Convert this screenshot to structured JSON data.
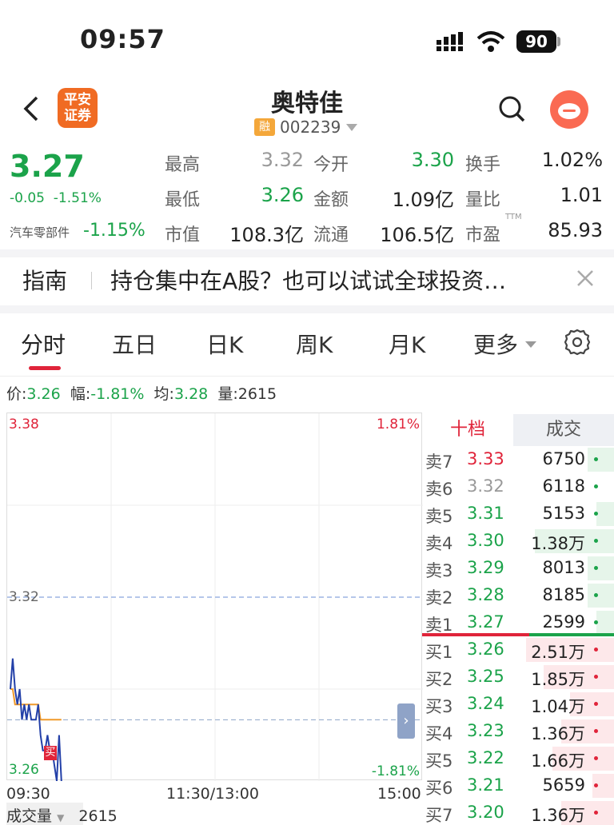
{
  "status_bar": {
    "time": "09:57",
    "battery": "90"
  },
  "header": {
    "title": "奥特佳",
    "rong_badge": "融",
    "code": "002239",
    "broker_logo": "平安\n证券"
  },
  "quote": {
    "price": "3.27",
    "change": "-0.05  -1.51%",
    "industry": "汽车零部件",
    "industry_change": "-1.15%",
    "grid": [
      {
        "label": "最高",
        "value": "3.32",
        "label2": "今开",
        "value2": "3.30",
        "label3": "换手",
        "value3": "1.02%"
      },
      {
        "label": "最低",
        "value": "3.26",
        "label2": "金额",
        "value2": "1.09亿",
        "label3": "量比",
        "value3": "1.01"
      },
      {
        "label": "市值",
        "value": "108.3亿",
        "label2": "流通",
        "value2": "106.5亿",
        "label3": "市盈",
        "value3": "85.93",
        "ttm": "TTM"
      }
    ]
  },
  "guide": {
    "label": "指南",
    "text": "持仓集中在A股？也可以试试全球投资…"
  },
  "tabs": [
    "分时",
    "五日",
    "日K",
    "周K",
    "月K",
    "更多"
  ],
  "info": {
    "price_label": "价:",
    "price": "3.26",
    "amp_label": "幅:",
    "amp": "-1.81%",
    "avg_label": "均:",
    "avg": "3.28",
    "vol_label": "量:",
    "vol": "2615"
  },
  "chart_data": {
    "type": "line",
    "y_top": "3.38",
    "y_mid": "3.32",
    "y_bottom": "3.26",
    "pct_top": "1.81%",
    "pct_bottom": "-1.81%",
    "x_labels": [
      "09:30",
      "11:30/13:00",
      "15:00"
    ],
    "ylim": [
      3.26,
      3.38
    ],
    "reference_price": 3.32,
    "marker_label": "买",
    "series": [
      {
        "values": [
          3.29,
          3.3,
          3.29,
          3.285,
          3.29,
          3.28,
          3.285,
          3.28,
          3.285,
          3.28,
          3.28,
          3.28,
          3.285,
          3.275,
          3.27,
          3.27,
          3.275,
          3.27,
          3.27,
          3.265,
          3.26,
          3.275,
          3.26
        ]
      },
      {
        "values": [
          3.29,
          3.29,
          3.285,
          3.285,
          3.285,
          3.285,
          3.285,
          3.285,
          3.285,
          3.285,
          3.285,
          3.285,
          3.285,
          3.28,
          3.28,
          3.28,
          3.28,
          3.28,
          3.28,
          3.28,
          3.28,
          3.28,
          3.28
        ]
      }
    ]
  },
  "order_book": {
    "tab_left": "十档",
    "tab_right": "成交",
    "asks": [
      {
        "label": "卖7",
        "price": "3.33",
        "vol": "6750",
        "color": "red",
        "bar": 0.3
      },
      {
        "label": "卖6",
        "price": "3.32",
        "vol": "6118",
        "color": "gray",
        "bar": 0.0
      },
      {
        "label": "卖5",
        "price": "3.31",
        "vol": "5153",
        "color": "green",
        "bar": 0.2
      },
      {
        "label": "卖4",
        "price": "3.30",
        "vol": "1.38万",
        "color": "green",
        "bar": 0.9
      },
      {
        "label": "卖3",
        "price": "3.29",
        "vol": "8013",
        "color": "green",
        "bar": 0.3
      },
      {
        "label": "卖2",
        "price": "3.28",
        "vol": "8185",
        "color": "green",
        "bar": 0.3
      },
      {
        "label": "卖1",
        "price": "3.27",
        "vol": "2599",
        "color": "green",
        "bar": 0.2
      }
    ],
    "bids": [
      {
        "label": "买1",
        "price": "3.26",
        "vol": "2.51万",
        "color": "green",
        "bar": 1.0
      },
      {
        "label": "买2",
        "price": "3.25",
        "vol": "1.85万",
        "color": "green",
        "bar": 0.8
      },
      {
        "label": "买3",
        "price": "3.24",
        "vol": "1.04万",
        "color": "green",
        "bar": 0.5
      },
      {
        "label": "买4",
        "price": "3.23",
        "vol": "1.36万",
        "color": "green",
        "bar": 0.6
      },
      {
        "label": "买5",
        "price": "3.22",
        "vol": "1.66万",
        "color": "green",
        "bar": 0.7
      },
      {
        "label": "买6",
        "price": "3.21",
        "vol": "5659",
        "color": "green",
        "bar": 0.25
      },
      {
        "label": "买7",
        "price": "3.20",
        "vol": "1.36万",
        "color": "green",
        "bar": 0.6
      }
    ]
  },
  "volume": {
    "label": "成交量",
    "value": "2615"
  },
  "colors": {
    "up": "#e0243a",
    "down": "#1ba34a",
    "flat": "#999999",
    "ask_bg": "#e6f5ea",
    "bid_bg": "#fde8ea"
  }
}
